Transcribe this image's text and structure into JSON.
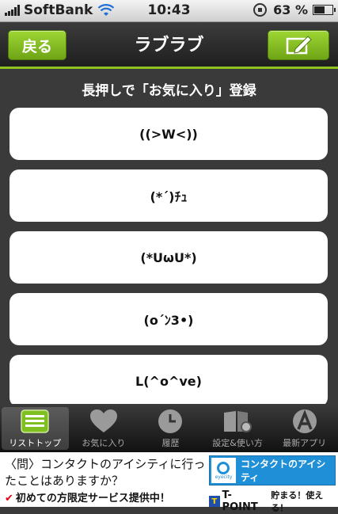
{
  "status_bar": {
    "carrier": "SoftBank",
    "time": "10:43",
    "battery_text": "63 %",
    "battery_level": 0.63,
    "icons": [
      "signal-bars-icon",
      "wifi-icon",
      "rotation-lock-icon",
      "battery-icon"
    ]
  },
  "nav": {
    "back_label": "戻る",
    "title": "ラブラブ",
    "edit_icon": "edit-note-icon"
  },
  "hint": "長押しで「お気に入り」登録",
  "items": [
    {
      "label": "((>W<))"
    },
    {
      "label": "(*´)ﾁｭ"
    },
    {
      "label": "(*UωU*)"
    },
    {
      "label": "(o´ﾝ3•)"
    },
    {
      "label": "L(^o^ve)"
    }
  ],
  "tabs": [
    {
      "label": "リストトップ",
      "icon": "list-icon",
      "active": true
    },
    {
      "label": "お気に入り",
      "icon": "heart-icon",
      "active": false
    },
    {
      "label": "履歴",
      "icon": "clock-icon",
      "active": false
    },
    {
      "label": "設定&使い方",
      "icon": "settings-book-icon",
      "active": false
    },
    {
      "label": "最新アプリ",
      "icon": "app-store-icon",
      "active": false
    }
  ],
  "ad": {
    "line1": "〈問〉コンタクトのアイシティに行ったことはありますか？",
    "line2": "初めての方限定サービス提供中！",
    "brand": "コンタクトのアイシティ",
    "brand_logo_text": "eyecity",
    "tpoint_text": "T-POINT",
    "tpoint_sub": "貯まる！使える！"
  }
}
